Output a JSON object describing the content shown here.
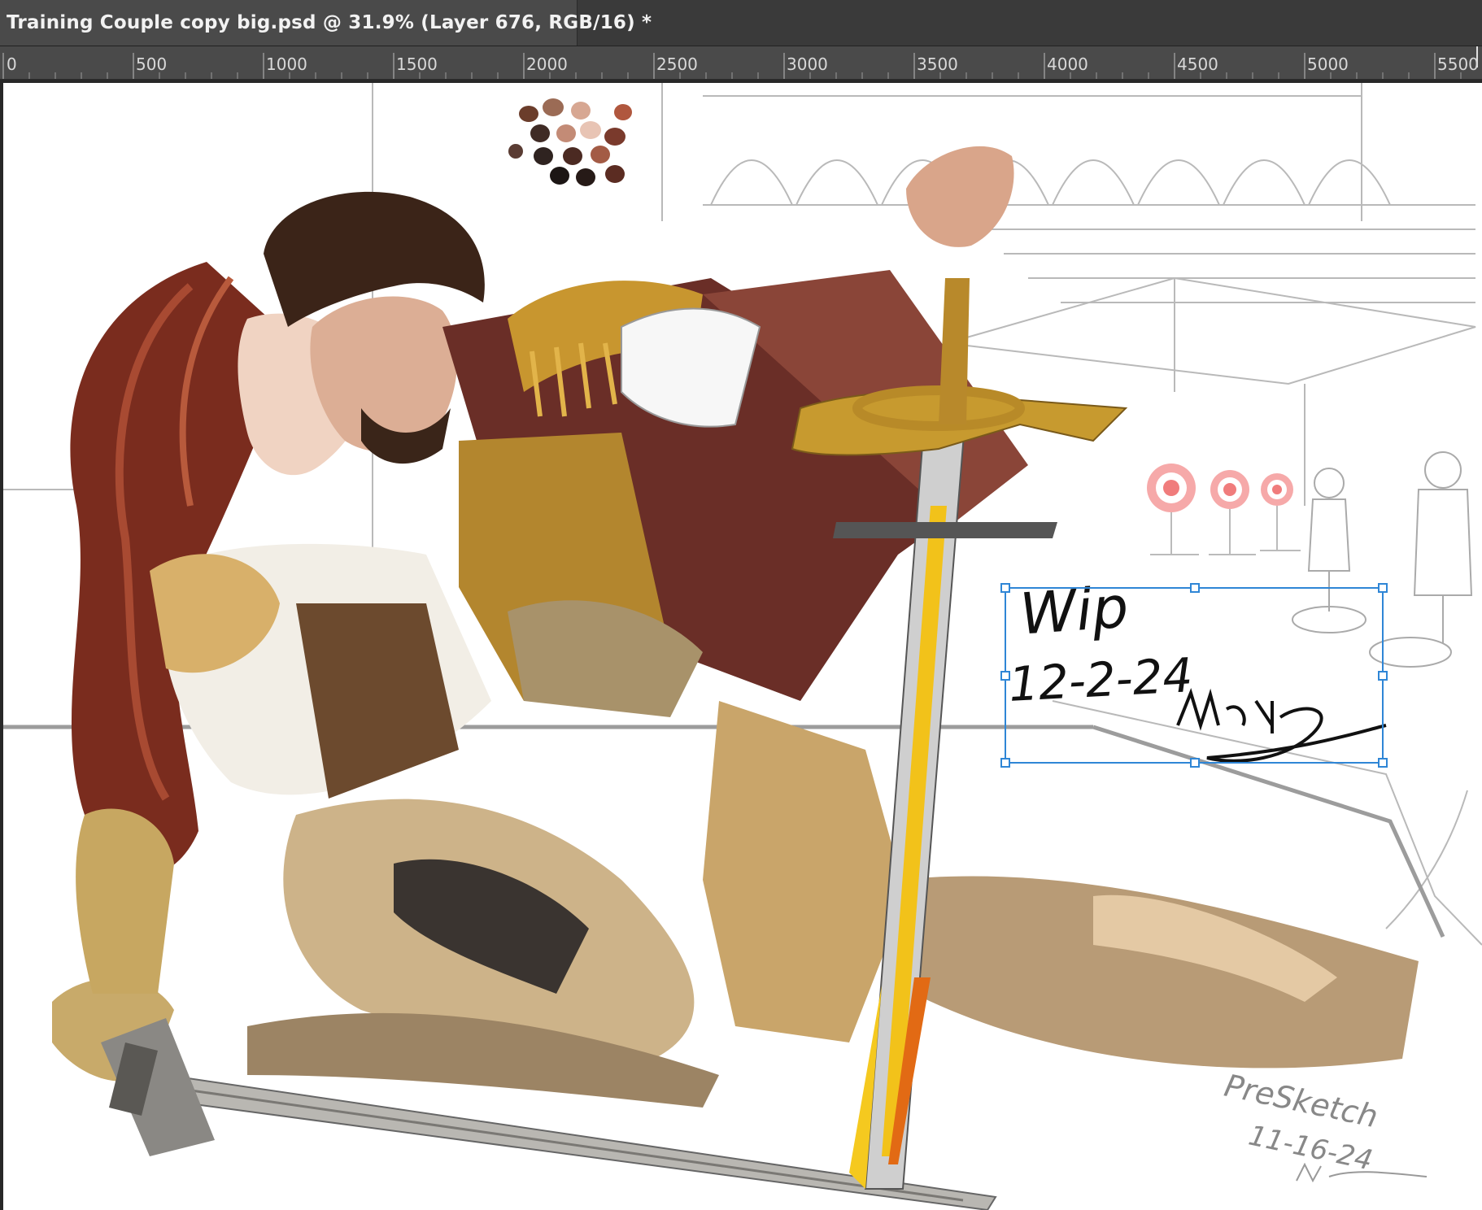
{
  "window": {
    "document_tab_title": "Training Couple copy big.psd @ 31.9% (Layer 676, RGB/16) *"
  },
  "ruler": {
    "labels": [
      "0",
      "500",
      "1000",
      "1500",
      "2000",
      "2500",
      "3000",
      "3500",
      "4000",
      "4500",
      "5000",
      "5500"
    ]
  },
  "canvas": {
    "annotation_wip": "Wip",
    "annotation_date": "12-2-24",
    "presketch_label": "PreSketch",
    "presketch_date": "11-16-24"
  },
  "colors": {
    "selection_accent": "#2f86d6",
    "target_red": "#f28b8b"
  }
}
